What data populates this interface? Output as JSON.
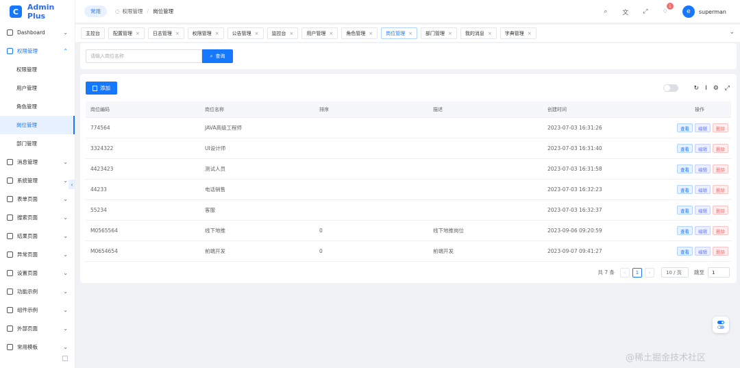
{
  "app": {
    "logo_letter": "C",
    "title": "Admin Plus",
    "brand_color": "#1677ff"
  },
  "sidebar": {
    "items": [
      {
        "label": "Dashboard",
        "icon": "dashboard-icon",
        "open": false
      },
      {
        "label": "权限管理",
        "icon": "lock-icon",
        "open": true,
        "children": [
          "权限管理",
          "用户管理",
          "角色管理",
          "岗位管理",
          "部门管理"
        ],
        "active_child": 3
      },
      {
        "label": "消息管理",
        "icon": "message-icon"
      },
      {
        "label": "系统管理",
        "icon": "system-icon"
      },
      {
        "label": "表单页面",
        "icon": "form-icon"
      },
      {
        "label": "搜索页面",
        "icon": "search-page-icon"
      },
      {
        "label": "结果页面",
        "icon": "result-icon"
      },
      {
        "label": "异常页面",
        "icon": "exception-icon"
      },
      {
        "label": "设置页面",
        "icon": "settings-icon"
      },
      {
        "label": "功能示例",
        "icon": "feature-icon"
      },
      {
        "label": "组件示例",
        "icon": "component-icon"
      },
      {
        "label": "外部页面",
        "icon": "external-icon"
      },
      {
        "label": "常用模板",
        "icon": "template-icon"
      }
    ]
  },
  "header": {
    "pill": "常用",
    "breadcrumb": [
      "权限管理",
      "岗位管理"
    ],
    "notification_count": "1",
    "username": "superman"
  },
  "tabs": [
    {
      "label": "主控台",
      "closable": false
    },
    {
      "label": "配置管理",
      "closable": true
    },
    {
      "label": "日志管理",
      "closable": true
    },
    {
      "label": "权限管理",
      "closable": true
    },
    {
      "label": "公告管理",
      "closable": true
    },
    {
      "label": "监控台",
      "closable": true
    },
    {
      "label": "用户管理",
      "closable": true
    },
    {
      "label": "角色管理",
      "closable": true
    },
    {
      "label": "岗位管理",
      "closable": true,
      "active": true
    },
    {
      "label": "部门管理",
      "closable": true
    },
    {
      "label": "我的消息",
      "closable": true
    },
    {
      "label": "字典管理",
      "closable": true
    }
  ],
  "search": {
    "placeholder": "请输入岗位名称",
    "button": "查询"
  },
  "table": {
    "add_button": "添加",
    "columns": [
      "岗位编码",
      "岗位名称",
      "排序",
      "描述",
      "创建时间",
      "操作"
    ],
    "rows": [
      [
        "774564",
        "JAVA高级工程师",
        "",
        "",
        "2023-07-03 16:31:26"
      ],
      [
        "3324322",
        "UI设计师",
        "",
        "",
        "2023-07-03 16:31:40"
      ],
      [
        "4423423",
        "测试人员",
        "",
        "",
        "2023-07-03 16:31:58"
      ],
      [
        "44233",
        "电话销售",
        "",
        "",
        "2023-07-03 16:32:23"
      ],
      [
        "55234",
        "客服",
        "",
        "",
        "2023-07-03 16:32:37"
      ],
      [
        "M0565564",
        "线下地推",
        "0",
        "线下地推岗位",
        "2023-09-06 09:20:59"
      ],
      [
        "M0654654",
        "前端开发",
        "0",
        "前端开发",
        "2023-09-07 09:41:27"
      ]
    ],
    "actions": [
      "查看",
      "编辑",
      "删除"
    ]
  },
  "pagination": {
    "total": "共 7 条",
    "current": "1",
    "page_size": "10 / 页",
    "jump_label": "跳至",
    "jump_value": "1"
  },
  "watermark": "@稀土掘金技术社区"
}
